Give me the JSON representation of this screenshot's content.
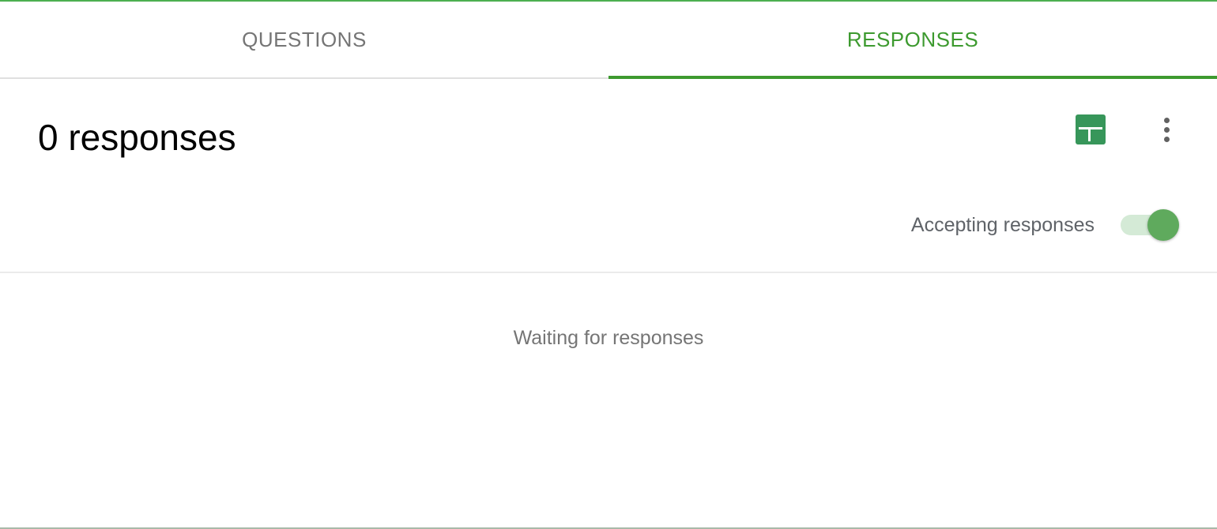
{
  "tabs": [
    {
      "label": "QUESTIONS",
      "active": false
    },
    {
      "label": "RESPONSES",
      "active": true
    }
  ],
  "summary": {
    "response_count": "0 responses",
    "sheets_icon": "google-sheets-icon",
    "more_icon": "more-vert-icon"
  },
  "accepting": {
    "label": "Accepting responses",
    "enabled": true
  },
  "empty_state": {
    "message": "Waiting for responses"
  },
  "colors": {
    "accent": "#3d9a2f",
    "sheets": "#37965a",
    "toggle_thumb": "#5faa5d",
    "toggle_track": "#d4ead6"
  }
}
